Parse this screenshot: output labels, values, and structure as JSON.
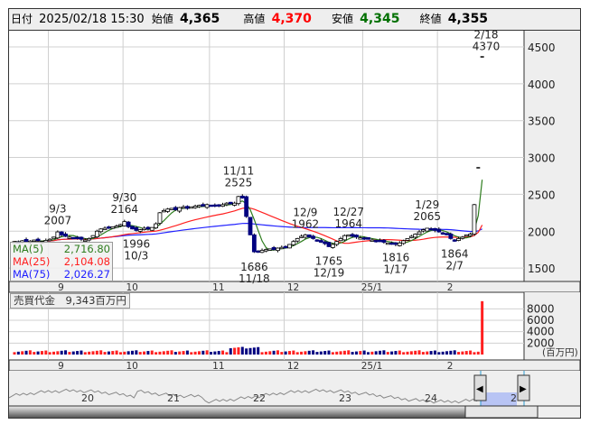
{
  "header": {
    "date_label": "日付",
    "date": "2025/02/18 15:30",
    "open_label": "始値",
    "open": "4,365",
    "high_label": "高値",
    "high": "4,370",
    "low_label": "安値",
    "low": "4,345",
    "close_label": "終値",
    "close": "4,355"
  },
  "colors": {
    "up": "#ffffff",
    "down": "#000080",
    "ma5": "#2e7d1e",
    "ma25": "#ff2020",
    "ma75": "#2020ff",
    "vol_up": "#ff2020",
    "vol_down": "#000080",
    "high": "#ff0000",
    "low": "#007000"
  },
  "legend": [
    {
      "label": "MA(5)",
      "value": "2,716.80"
    },
    {
      "label": "MA(25)",
      "value": "2,104.08"
    },
    {
      "label": "MA(75)",
      "value": "2,026.27"
    }
  ],
  "volume_label": "売買代金　9,343百万円",
  "volume_unit": "(百万円)",
  "chart_data": {
    "type": "candlestick",
    "price_axis": {
      "ticks": [
        1500,
        2000,
        2500,
        3000,
        3500,
        4000,
        4500
      ],
      "range": [
        1350,
        4750
      ]
    },
    "month_labels": [
      "9",
      "10",
      "11",
      "12",
      "25/1",
      "2"
    ],
    "month_start_index": [
      10,
      29,
      51,
      70,
      90,
      109
    ],
    "closes": [
      1860,
      1850,
      1870,
      1855,
      1865,
      1880,
      1870,
      1860,
      1875,
      1890,
      1920,
      1990,
      1950,
      1930,
      1920,
      1910,
      1900,
      1890,
      1880,
      1900,
      1940,
      2000,
      2030,
      2040,
      2050,
      2060,
      2070,
      2090,
      2130,
      2060,
      2030,
      2010,
      2020,
      2040,
      2030,
      2050,
      2100,
      2250,
      2280,
      2300,
      2310,
      2290,
      2320,
      2330,
      2310,
      2330,
      2340,
      2350,
      2340,
      2360,
      2350,
      2340,
      2350,
      2360,
      2380,
      2370,
      2380,
      2470,
      2450,
      2200,
      1950,
      1720,
      1730,
      1740,
      1750,
      1760,
      1750,
      1770,
      1780,
      1790,
      1820,
      1860,
      1900,
      1930,
      1950,
      1920,
      1900,
      1880,
      1850,
      1830,
      1790,
      1820,
      1860,
      1900,
      1940,
      1950,
      1930,
      1920,
      1910,
      1900,
      1890,
      1880,
      1870,
      1860,
      1850,
      1840,
      1830,
      1820,
      1840,
      1870,
      1900,
      1930,
      1960,
      1990,
      2020,
      2040,
      2030,
      2010,
      1990,
      1970,
      1950,
      1900,
      1880,
      1900,
      1920,
      1950,
      1960,
      2360,
      2860,
      4365
    ],
    "limit_days": [
      118,
      119,
      120
    ],
    "annotations": [
      {
        "index": 11,
        "date": "9/3",
        "price": 2007,
        "pos": "above"
      },
      {
        "index": 28,
        "date": "9/30",
        "price": 2164,
        "pos": "above"
      },
      {
        "index": 31,
        "date": "10/3",
        "price": 1996,
        "pos": "below"
      },
      {
        "index": 57,
        "date": "11/11",
        "price": 2525,
        "pos": "above"
      },
      {
        "index": 61,
        "date": "11/18",
        "price": 1686,
        "pos": "below"
      },
      {
        "index": 74,
        "date": "12/9",
        "price": 1962,
        "pos": "above"
      },
      {
        "index": 80,
        "date": "12/19",
        "price": 1765,
        "pos": "below"
      },
      {
        "index": 85,
        "date": "12/27",
        "price": 1964,
        "pos": "above"
      },
      {
        "index": 97,
        "date": "1/17",
        "price": 1816,
        "pos": "below"
      },
      {
        "index": 105,
        "date": "1/29",
        "price": 2065,
        "pos": "above"
      },
      {
        "index": 112,
        "date": "2/7",
        "price": 1864,
        "pos": "below"
      },
      {
        "index": 120,
        "date": "2/18",
        "price": 4370,
        "pos": "above"
      }
    ],
    "volume": {
      "ticks": [
        2000,
        4000,
        6000,
        8000
      ],
      "last": 9343,
      "base": 420
    },
    "navigator": {
      "labels": [
        "20",
        "21",
        "22",
        "23",
        "24",
        "2"
      ]
    }
  }
}
